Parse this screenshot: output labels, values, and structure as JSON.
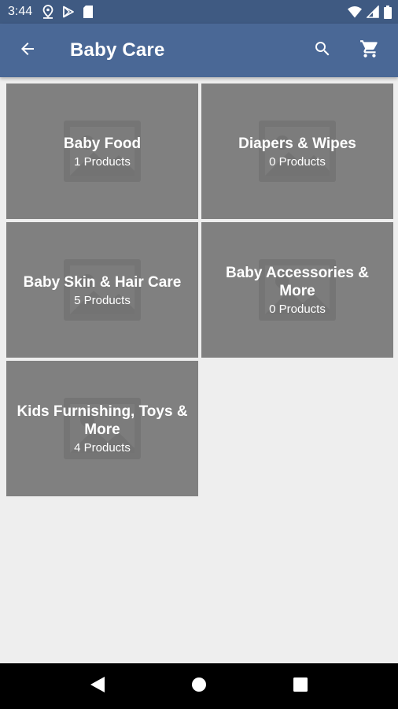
{
  "status_bar": {
    "time": "3:44",
    "left_icons": [
      "location-icon",
      "play-store-icon",
      "sd-card-icon"
    ],
    "right_icons": [
      "wifi-icon",
      "signal-icon",
      "battery-icon"
    ]
  },
  "app_bar": {
    "title": "Baby Care",
    "back_icon": "arrow-back-icon",
    "actions": [
      "search-icon",
      "cart-icon"
    ]
  },
  "categories": [
    {
      "name": "Baby Food",
      "count": "1 Products"
    },
    {
      "name": "Diapers & Wipes",
      "count": "0 Products"
    },
    {
      "name": "Baby Skin & Hair Care",
      "count": "5 Products"
    },
    {
      "name": "Baby Accessories & More",
      "count": "0 Products"
    },
    {
      "name": "Kids Furnishing, Toys & More",
      "count": "4 Products"
    }
  ],
  "nav_bar": {
    "buttons": [
      "back-triangle-icon",
      "home-circle-icon",
      "recents-square-icon"
    ]
  },
  "colors": {
    "status_bar": "#3f5a82",
    "app_bar": "#4a6896",
    "tile": "#808080",
    "background": "#eeeeee"
  }
}
